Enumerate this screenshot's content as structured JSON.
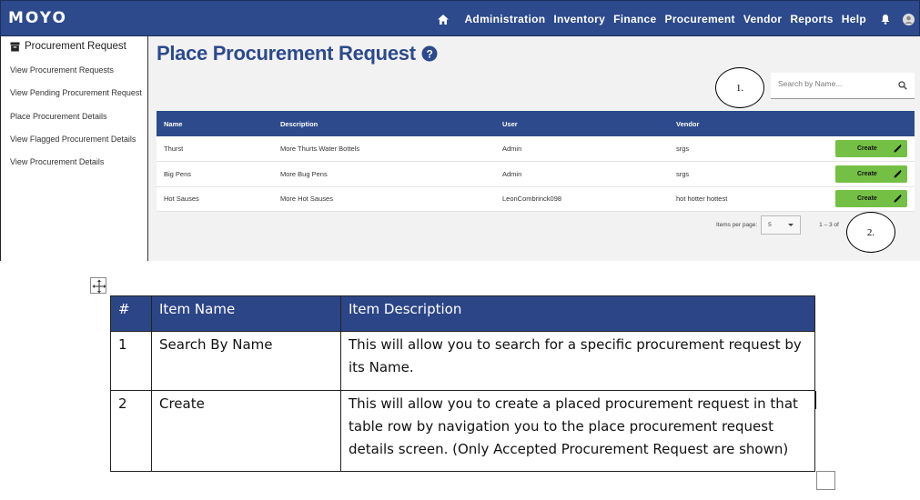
{
  "app": {
    "logo": "MOYO",
    "nav": {
      "items": [
        "Administration",
        "Inventory",
        "Finance",
        "Procurement",
        "Vendor",
        "Reports",
        "Help"
      ]
    },
    "colors": {
      "brand": "#2c4a8c",
      "create_button": "#74c045"
    }
  },
  "sidebar": {
    "heading": "Procurement Request",
    "items": [
      "View Procurement Requests",
      "View Pending Procurement Request",
      "Place Procurement Details",
      "View Flagged Procurement Details",
      "View Procurement Details"
    ]
  },
  "main": {
    "title": "Place Procurement Request",
    "search": {
      "placeholder": "Search by Name..."
    },
    "table": {
      "headers": [
        "Name",
        "Description",
        "User",
        "Vendor"
      ],
      "rows": [
        {
          "name": "Thurst",
          "description": "More Thurts Water Bottels",
          "user": "Admin",
          "vendor": "srgs",
          "action": "Create"
        },
        {
          "name": "Big Pens",
          "description": "More Bug Pens",
          "user": "Admin",
          "vendor": "srgs",
          "action": "Create"
        },
        {
          "name": "Hot Sauses",
          "description": "More Hot Sauses",
          "user": "LeonCombrinck098",
          "vendor": "hot hotter hottest",
          "action": "Create"
        }
      ]
    },
    "pager": {
      "items_per_page_label": "Items per page:",
      "page_size": "5",
      "range": "1 – 3 of"
    }
  },
  "callouts": [
    "1.",
    "2."
  ],
  "doc_table": {
    "headers": [
      "#",
      "Item Name",
      "Item Description"
    ],
    "rows": [
      {
        "num": "1",
        "name": "Search By Name",
        "description": "This will allow you to search for a specific procurement request by its Name."
      },
      {
        "num": "2",
        "name": "Create",
        "description": "This will allow you to create a placed procurement request in that table row by navigation you to the place procurement request details screen. (Only Accepted Procurement Request are shown)"
      }
    ]
  }
}
